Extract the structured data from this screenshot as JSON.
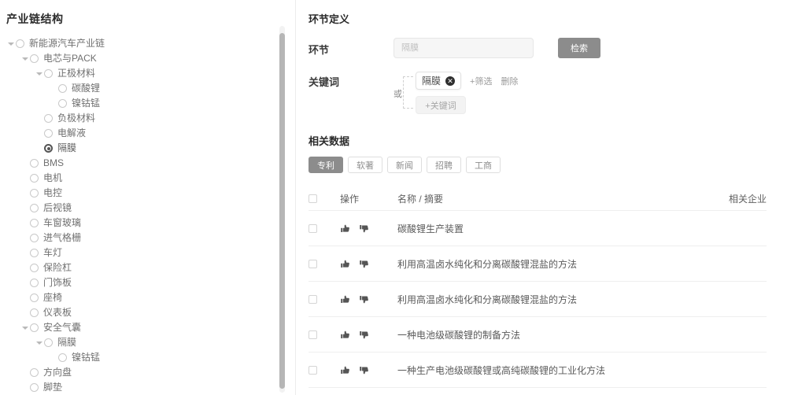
{
  "left": {
    "title": "产业链结构",
    "tree": [
      {
        "label": "新能源汽车产业链",
        "depth": 0,
        "caret": true,
        "selected": false
      },
      {
        "label": "电芯与PACK",
        "depth": 1,
        "caret": true,
        "selected": false
      },
      {
        "label": "正极材料",
        "depth": 2,
        "caret": true,
        "selected": false
      },
      {
        "label": "碳酸锂",
        "depth": 3,
        "caret": false,
        "selected": false
      },
      {
        "label": "镍钴锰",
        "depth": 3,
        "caret": false,
        "selected": false
      },
      {
        "label": "负极材料",
        "depth": 2,
        "caret": false,
        "selected": false
      },
      {
        "label": "电解液",
        "depth": 2,
        "caret": false,
        "selected": false
      },
      {
        "label": "隔膜",
        "depth": 2,
        "caret": false,
        "selected": true
      },
      {
        "label": "BMS",
        "depth": 1,
        "caret": false,
        "selected": false
      },
      {
        "label": "电机",
        "depth": 1,
        "caret": false,
        "selected": false
      },
      {
        "label": "电控",
        "depth": 1,
        "caret": false,
        "selected": false
      },
      {
        "label": "后视镜",
        "depth": 1,
        "caret": false,
        "selected": false
      },
      {
        "label": "车窗玻璃",
        "depth": 1,
        "caret": false,
        "selected": false
      },
      {
        "label": "进气格栅",
        "depth": 1,
        "caret": false,
        "selected": false
      },
      {
        "label": "车灯",
        "depth": 1,
        "caret": false,
        "selected": false
      },
      {
        "label": "保险杠",
        "depth": 1,
        "caret": false,
        "selected": false
      },
      {
        "label": "门饰板",
        "depth": 1,
        "caret": false,
        "selected": false
      },
      {
        "label": "座椅",
        "depth": 1,
        "caret": false,
        "selected": false
      },
      {
        "label": "仪表板",
        "depth": 1,
        "caret": false,
        "selected": false
      },
      {
        "label": "安全气囊",
        "depth": 1,
        "caret": true,
        "selected": false
      },
      {
        "label": "隔膜",
        "depth": 2,
        "caret": true,
        "selected": false
      },
      {
        "label": "镍钴锰",
        "depth": 3,
        "caret": false,
        "selected": false
      },
      {
        "label": "方向盘",
        "depth": 1,
        "caret": false,
        "selected": false
      },
      {
        "label": "脚垫",
        "depth": 1,
        "caret": false,
        "selected": false
      }
    ]
  },
  "right": {
    "section_title": "环节定义",
    "segment": {
      "label": "环节",
      "input_value": "",
      "placeholder": "隔膜",
      "search_label": "检索"
    },
    "keyword": {
      "label": "关键词",
      "or_label": "或",
      "tags": [
        {
          "text": "隔膜",
          "close": "✕"
        }
      ],
      "filter_label": "+筛选",
      "delete_label": "删除",
      "add_label": "+关键词"
    },
    "related": {
      "title": "相关数据",
      "tabs": [
        {
          "label": "专利",
          "active": true
        },
        {
          "label": "软著",
          "active": false
        },
        {
          "label": "新闻",
          "active": false
        },
        {
          "label": "招聘",
          "active": false
        },
        {
          "label": "工商",
          "active": false
        }
      ],
      "columns": {
        "checkbox": "",
        "operation": "操作",
        "name": "名称 / 摘要",
        "enterprise": "相关企业"
      },
      "rows": [
        {
          "name": "碳酸锂生产装置",
          "enterprise": ""
        },
        {
          "name": "利用高温卤水纯化和分离碳酸锂混盐的方法",
          "enterprise": ""
        },
        {
          "name": "利用高温卤水纯化和分离碳酸锂混盐的方法",
          "enterprise": ""
        },
        {
          "name": "一种电池级碳酸锂的制备方法",
          "enterprise": ""
        },
        {
          "name": "一种生产电池级碳酸锂或高纯碳酸锂的工业化方法",
          "enterprise": ""
        }
      ]
    }
  },
  "colors": {
    "accent": "#8c8c8c",
    "text": "#5a5a5a",
    "border": "#eeeeee"
  }
}
